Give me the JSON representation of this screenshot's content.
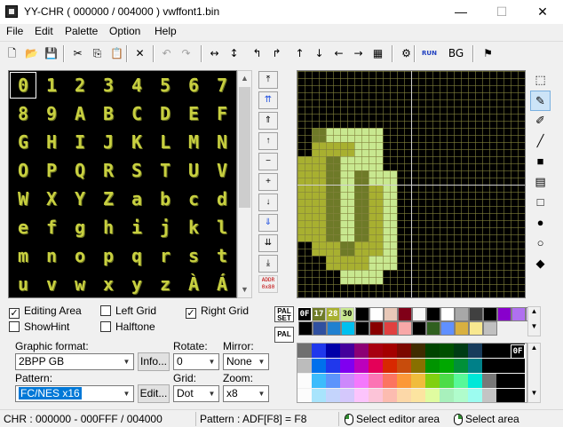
{
  "window": {
    "title": "YY-CHR ( 000000 / 004000 ) vwffont1.bin",
    "minimize": "—",
    "maximize": "☐",
    "close": "✕"
  },
  "menu": [
    "File",
    "Edit",
    "Palette",
    "Option",
    "Help"
  ],
  "toolbar": [
    {
      "name": "new-file-icon",
      "glyph": "🗋"
    },
    {
      "name": "open-folder-icon",
      "glyph": "📂"
    },
    {
      "name": "save-icon",
      "glyph": "💾"
    },
    {
      "name": "cut-icon",
      "glyph": "✂"
    },
    {
      "name": "copy-icon",
      "glyph": "⎘"
    },
    {
      "name": "paste-icon",
      "glyph": "📋"
    },
    {
      "name": "delete-icon",
      "glyph": "✕"
    },
    {
      "name": "undo-icon",
      "glyph": "↶"
    },
    {
      "name": "redo-icon",
      "glyph": "↷"
    },
    {
      "name": "flip-horizontal-icon",
      "glyph": "↔"
    },
    {
      "name": "flip-vertical-icon",
      "glyph": "↕"
    },
    {
      "name": "rotate-left-icon",
      "glyph": "↰"
    },
    {
      "name": "rotate-right-icon",
      "glyph": "↱"
    },
    {
      "name": "shift-up-icon",
      "glyph": "↑"
    },
    {
      "name": "shift-down-icon",
      "glyph": "↓"
    },
    {
      "name": "shift-left-icon",
      "glyph": "←"
    },
    {
      "name": "shift-right-icon",
      "glyph": "→"
    },
    {
      "name": "color-grid-icon",
      "glyph": "▦"
    },
    {
      "name": "script-icon",
      "glyph": "⚙"
    },
    {
      "name": "run-icon",
      "glyph": "RUN"
    },
    {
      "name": "bg-set-icon",
      "glyph": "BG"
    },
    {
      "name": "bookmark-icon",
      "glyph": "⚑"
    }
  ],
  "tiles": [
    "0",
    "1",
    "2",
    "3",
    "4",
    "5",
    "6",
    "7",
    "8",
    "9",
    "A",
    "B",
    "C",
    "D",
    "E",
    "F",
    "G",
    "H",
    "I",
    "J",
    "K",
    "L",
    "M",
    "N",
    "O",
    "P",
    "Q",
    "R",
    "S",
    "T",
    "U",
    "V",
    "W",
    "X",
    "Y",
    "Z",
    "a",
    "b",
    "c",
    "d",
    "e",
    "f",
    "g",
    "h",
    "i",
    "j",
    "k",
    "l",
    "m",
    "n",
    "o",
    "p",
    "q",
    "r",
    "s",
    "t",
    "u",
    "v",
    "w",
    "x",
    "y",
    "z",
    "À",
    "Á"
  ],
  "nav_buttons": [
    "⤒",
    "⇈",
    "⇑",
    "↑",
    "−",
    "+",
    "↓",
    "⇓",
    "⇊",
    "⤓"
  ],
  "addr_label": "ADDR\n0x80",
  "tools": [
    {
      "name": "select-tool-icon",
      "glyph": "⬚"
    },
    {
      "name": "pen-tool-icon",
      "glyph": "✎"
    },
    {
      "name": "brush-tool-icon",
      "glyph": "✐"
    },
    {
      "name": "line-tool-icon",
      "glyph": "╱"
    },
    {
      "name": "filled-rect-tool-icon",
      "glyph": "■"
    },
    {
      "name": "pattern-tool-icon",
      "glyph": "▤"
    },
    {
      "name": "rect-tool-icon",
      "glyph": "□"
    },
    {
      "name": "filled-circle-tool-icon",
      "glyph": "●"
    },
    {
      "name": "circle-tool-icon",
      "glyph": "○"
    },
    {
      "name": "fill-tool-icon",
      "glyph": "◆"
    }
  ],
  "options": {
    "editing_area": {
      "label": "Editing Area",
      "checked": true
    },
    "left_grid": {
      "label": "Left Grid",
      "checked": false
    },
    "right_grid": {
      "label": "Right Grid",
      "checked": true
    },
    "show_hint": {
      "label": "ShowHint",
      "checked": false
    },
    "halftone": {
      "label": "Halftone",
      "checked": false
    }
  },
  "graphic_format": {
    "label": "Graphic format:",
    "value": "2BPP GB",
    "button": "Info..."
  },
  "rotate": {
    "label": "Rotate:",
    "value": "0"
  },
  "mirror": {
    "label": "Mirror:",
    "value": "None"
  },
  "pattern": {
    "label": "Pattern:",
    "value": "FC/NES x16",
    "button": "Edit..."
  },
  "grid": {
    "label": "Grid:",
    "value": "Dot"
  },
  "zoom": {
    "label": "Zoom:",
    "value": "x8"
  },
  "palette": {
    "pal_set": "PAL SET",
    "pal": "PAL",
    "sub": [
      {
        "label": "0F",
        "color": "#000000"
      },
      {
        "label": "17",
        "color": "#6e7a28"
      },
      {
        "label": "28",
        "color": "#a8b030"
      },
      {
        "label": "30",
        "color": "#c8e890"
      }
    ],
    "row1_colors": [
      "#000000",
      "#ffffff",
      "#e8c8b8",
      "#800018",
      "#f8f8f8",
      "#000000",
      "#ffffff",
      "#a8a8a8",
      "#404040",
      "#000000",
      "#8800cc",
      "#b070f0",
      "#e0c0ff"
    ],
    "row2_colors": [
      "#000000",
      "#3050a0",
      "#2080d0",
      "#00c0f0",
      "#000000",
      "#880000",
      "#e04040",
      "#f8a8a8",
      "#000000",
      "#306020",
      "#6090ff",
      "#d8b040",
      "#f8e890",
      "#c0c0c0"
    ],
    "big_rows": [
      [
        "#707070",
        "#2038ec",
        "#0000a8",
        "#44009c",
        "#8c0074",
        "#a80010",
        "#a40000",
        "#7c0800",
        "#402c00",
        "#004400",
        "#005000",
        "#003c14",
        "#183c5c",
        "#000000",
        "#000000",
        "#000000"
      ],
      [
        "#bcbcbc",
        "#0070ec",
        "#2038ec",
        "#8000f0",
        "#bc00bc",
        "#e40058",
        "#d82800",
        "#c84c0c",
        "#887000",
        "#009400",
        "#00a800",
        "#009038",
        "#008088",
        "#000000",
        "#000000",
        "#000000"
      ],
      [
        "#fcfcfc",
        "#3cbcfc",
        "#5c94fc",
        "#cc88fc",
        "#f478fc",
        "#fc74b4",
        "#fc7460",
        "#fc9838",
        "#f0bc3c",
        "#80d010",
        "#4cdc48",
        "#58f898",
        "#00e8d8",
        "#787878",
        "#000000",
        "#000000"
      ],
      [
        "#fcfcfc",
        "#a8e4fc",
        "#c4d4fc",
        "#d4c8fc",
        "#fcc4fc",
        "#fcc4d8",
        "#fcbcb0",
        "#fcd8a8",
        "#fce4a0",
        "#e0fca0",
        "#a8f0bc",
        "#b0fccc",
        "#9cfcf0",
        "#c4c4c4",
        "#000000",
        "#000000"
      ]
    ],
    "big_selected": "0F"
  },
  "edit_pixels": {
    "a": [
      [
        1,
        5
      ],
      [
        2,
        5
      ],
      [
        3,
        5
      ],
      [
        0,
        6
      ],
      [
        1,
        6
      ],
      [
        0,
        7
      ],
      [
        1,
        7
      ],
      [
        0,
        8
      ],
      [
        1,
        8
      ],
      [
        0,
        9
      ],
      [
        1,
        9
      ],
      [
        0,
        10
      ],
      [
        1,
        10
      ],
      [
        0,
        11
      ],
      [
        1,
        11
      ],
      [
        1,
        12
      ],
      [
        2,
        12
      ],
      [
        5,
        8
      ],
      [
        5,
        9
      ],
      [
        5,
        10
      ],
      [
        5,
        11
      ],
      [
        4,
        12
      ],
      [
        5,
        12
      ],
      [
        2,
        13
      ],
      [
        3,
        13
      ],
      [
        4,
        13
      ]
    ],
    "b": [
      [
        2,
        4
      ],
      [
        3,
        4
      ],
      [
        4,
        4
      ],
      [
        5,
        4
      ],
      [
        3,
        6
      ],
      [
        4,
        6
      ],
      [
        3,
        7
      ],
      [
        3,
        8
      ],
      [
        3,
        9
      ],
      [
        3,
        10
      ],
      [
        3,
        11
      ],
      [
        4,
        5
      ],
      [
        5,
        5
      ],
      [
        5,
        6
      ],
      [
        5,
        7
      ],
      [
        6,
        7
      ],
      [
        6,
        8
      ],
      [
        6,
        9
      ],
      [
        6,
        10
      ],
      [
        6,
        11
      ],
      [
        6,
        12
      ],
      [
        5,
        13
      ],
      [
        6,
        13
      ],
      [
        3,
        14
      ],
      [
        4,
        14
      ],
      [
        5,
        14
      ]
    ],
    "c": [
      [
        2,
        6
      ],
      [
        2,
        7
      ],
      [
        2,
        8
      ],
      [
        2,
        9
      ],
      [
        2,
        10
      ],
      [
        2,
        11
      ],
      [
        4,
        7
      ],
      [
        4,
        8
      ],
      [
        4,
        9
      ],
      [
        4,
        10
      ],
      [
        4,
        11
      ],
      [
        3,
        12
      ],
      [
        4,
        5
      ],
      [
        1,
        4
      ]
    ]
  },
  "status": {
    "chr": "CHR : 000000 - 000FFF / 004000",
    "pattern": "Pattern : ADF[F8] = F8",
    "select_editor": "Select editor area",
    "select_area": "Select area"
  }
}
